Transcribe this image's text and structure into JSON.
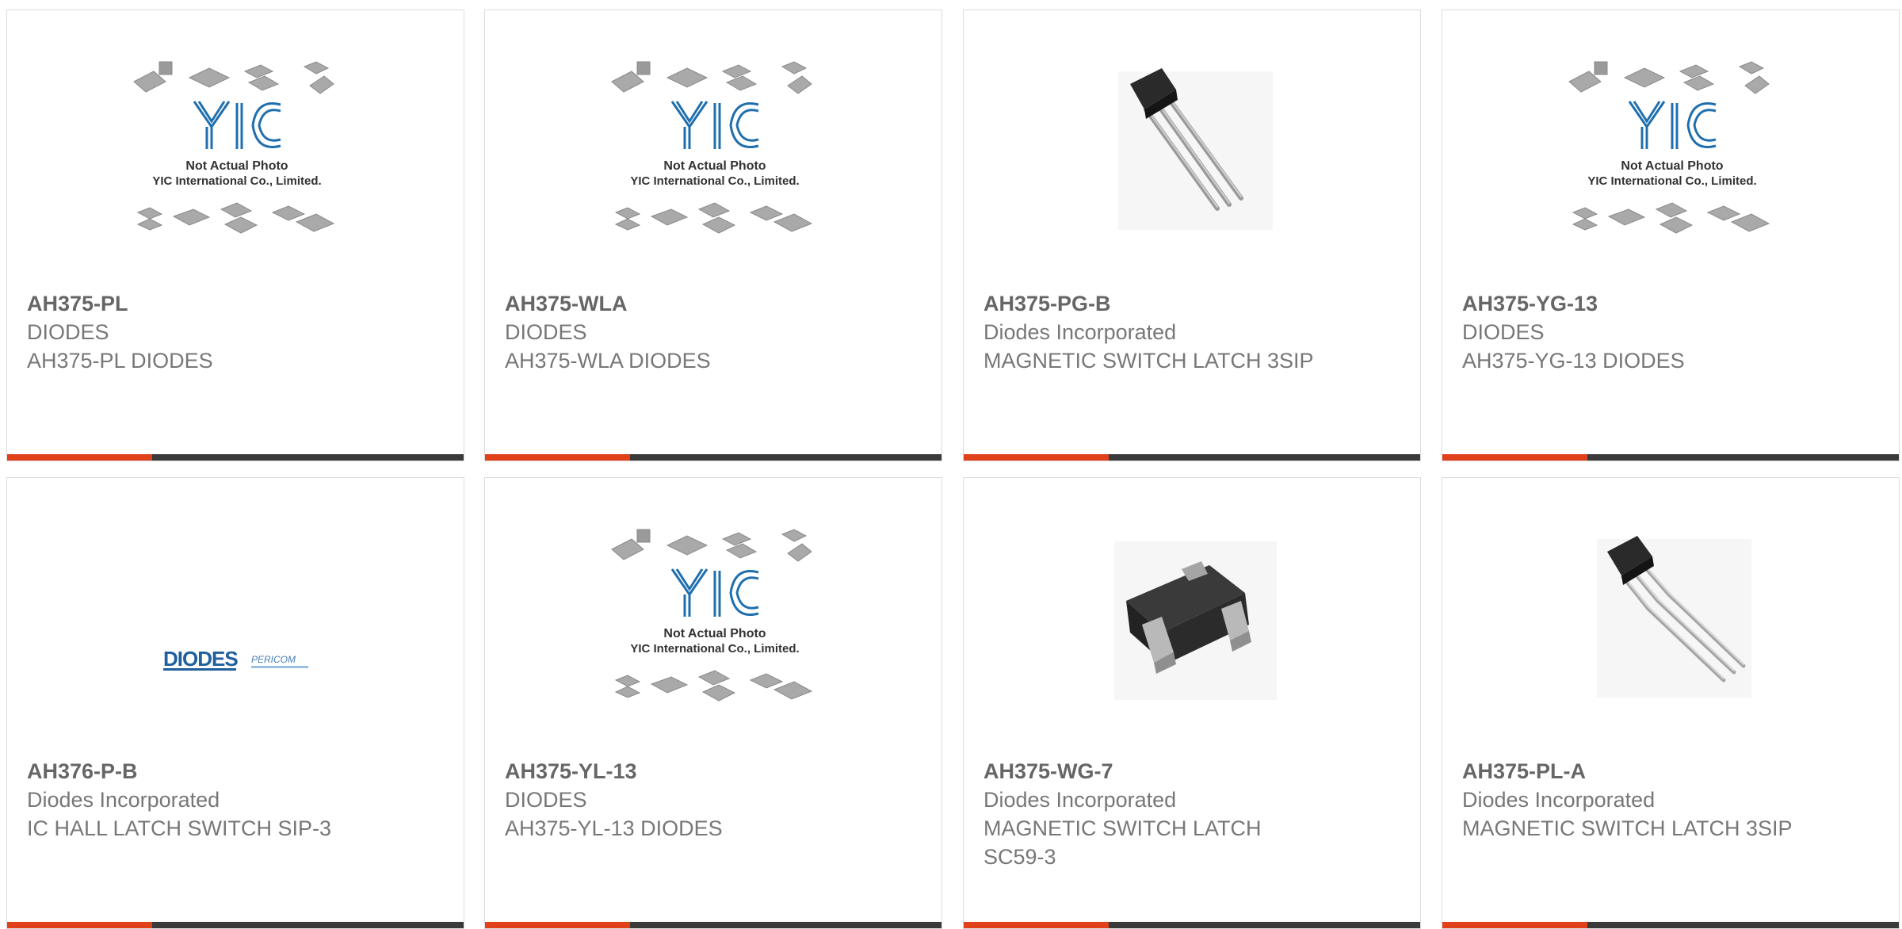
{
  "colors": {
    "accent": "#e0401a",
    "bar_dark": "#3a3a3a",
    "text_title": "#666666",
    "text_body": "#777777",
    "logo_blue": "#1f6fae"
  },
  "placeholder": {
    "line1": "Not Actual Photo",
    "line2": "YIC International Co., Limited.",
    "logo_text": "YIC"
  },
  "diodes_logo": {
    "brand": "DIODES",
    "sub": "PERICOM"
  },
  "products": [
    {
      "part": "AH375-PL",
      "maker": "DIODES",
      "desc": "AH375-PL DIODES",
      "image": "yic-placeholder-image"
    },
    {
      "part": "AH375-WLA",
      "maker": "DIODES",
      "desc": "AH375-WLA DIODES",
      "image": "yic-placeholder-image"
    },
    {
      "part": "AH375-PG-B",
      "maker": "Diodes Incorporated",
      "desc": "MAGNETIC SWITCH LATCH 3SIP",
      "image": "sip3-component-image"
    },
    {
      "part": "AH375-YG-13",
      "maker": "DIODES",
      "desc": "AH375-YG-13 DIODES",
      "image": "yic-placeholder-image"
    },
    {
      "part": "AH376-P-B",
      "maker": "Diodes Incorporated",
      "desc": "IC HALL LATCH SWITCH SIP-3",
      "image": "diodes-logo-image"
    },
    {
      "part": "AH375-YL-13",
      "maker": "DIODES",
      "desc": "AH375-YL-13 DIODES",
      "image": "yic-placeholder-image"
    },
    {
      "part": "AH375-WG-7",
      "maker": "Diodes Incorporated",
      "desc": "MAGNETIC SWITCH LATCH SC59-3",
      "image": "sc59-component-image"
    },
    {
      "part": "AH375-PL-A",
      "maker": "Diodes Incorporated",
      "desc": "MAGNETIC SWITCH LATCH 3SIP",
      "image": "sip3-component-image"
    }
  ]
}
